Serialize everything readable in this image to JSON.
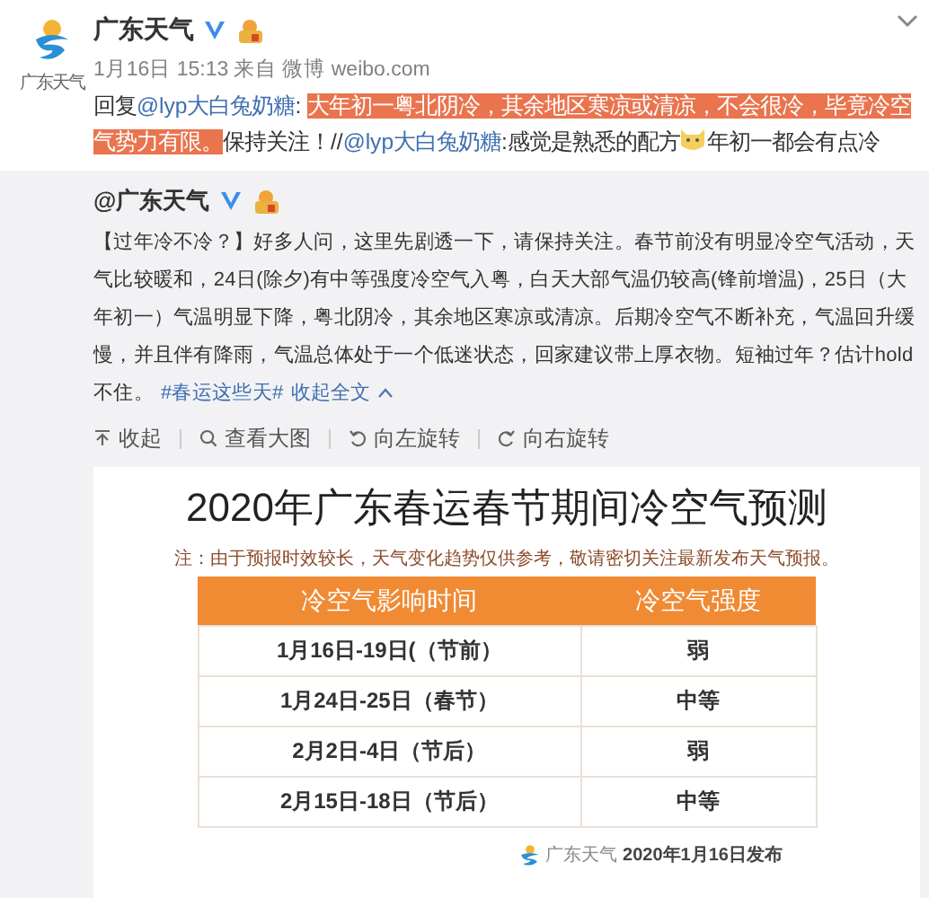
{
  "post": {
    "avatar_caption": "广东天气",
    "author": "广东天气",
    "verified": true,
    "member": true,
    "time": "1月16日 15:13",
    "source_prefix": "来自",
    "source": "微博 weibo.com",
    "text": [
      {
        "kind": "text",
        "text": "回复"
      },
      {
        "kind": "mention",
        "text": "@lyp大白兔奶糖"
      },
      {
        "kind": "text",
        "text": ": "
      },
      {
        "kind": "highlight",
        "text": "大年初一粤北阴冷，其余地区寒凉或清凉，不会很冷，毕竟冷空气势力有限。"
      },
      {
        "kind": "text",
        "text": "保持关注！//"
      },
      {
        "kind": "mention",
        "text": "@lyp大白兔奶糖"
      },
      {
        "kind": "text",
        "text": ":感觉是熟悉的配方"
      },
      {
        "kind": "emoji"
      },
      {
        "kind": "text",
        "text": "年初一都会有点冷"
      }
    ]
  },
  "original": {
    "author": "@广东天气",
    "verified": true,
    "member": true,
    "text": [
      {
        "kind": "text",
        "text": "【过年冷不冷？】好多人问，这里先剧透一下，请保持关注。春节前没有明显冷空气活动，天气比较暖和，24日(除夕)有中等强度冷空气入粤，白天大部气温仍较高(锋前增温)，25日（大年初一）气温明显下降，粤北阴冷，其余地区寒凉或清凉。后期冷空气不断补充，气温回升缓慢，并且伴有降雨，气温总体处于一个低迷状态，回家建议带上厚衣物。短袖过年？估计hold不住。"
      },
      {
        "kind": "hashtag",
        "text": "#春运这些天#"
      },
      {
        "kind": "toggle",
        "text": "收起全文"
      }
    ]
  },
  "actions": [
    {
      "kind": "collapse",
      "label": "收起"
    },
    {
      "kind": "zoom",
      "label": "查看大图"
    },
    {
      "kind": "rotate_left",
      "label": "向左旋转"
    },
    {
      "kind": "rotate_right",
      "label": "向右旋转"
    }
  ],
  "image": {
    "title": "2020年广东春运春节期间冷空气预测",
    "note": "注：由于预报时效较长，天气变化趋势仅供参考，敬请密切关注最新发布天气预报。",
    "columns": [
      "冷空气影响时间",
      "冷空气强度"
    ],
    "rows": [
      [
        "1月16日-19日(（节前）",
        "弱"
      ],
      [
        "1月24日-25日（春节）",
        "中等"
      ],
      [
        "2月2日-4日（节后）",
        "弱"
      ],
      [
        "2月15日-18日（节后）",
        "中等"
      ]
    ],
    "footer_logo_caption": "广东天气",
    "footer": "2020年1月16日发布"
  }
}
